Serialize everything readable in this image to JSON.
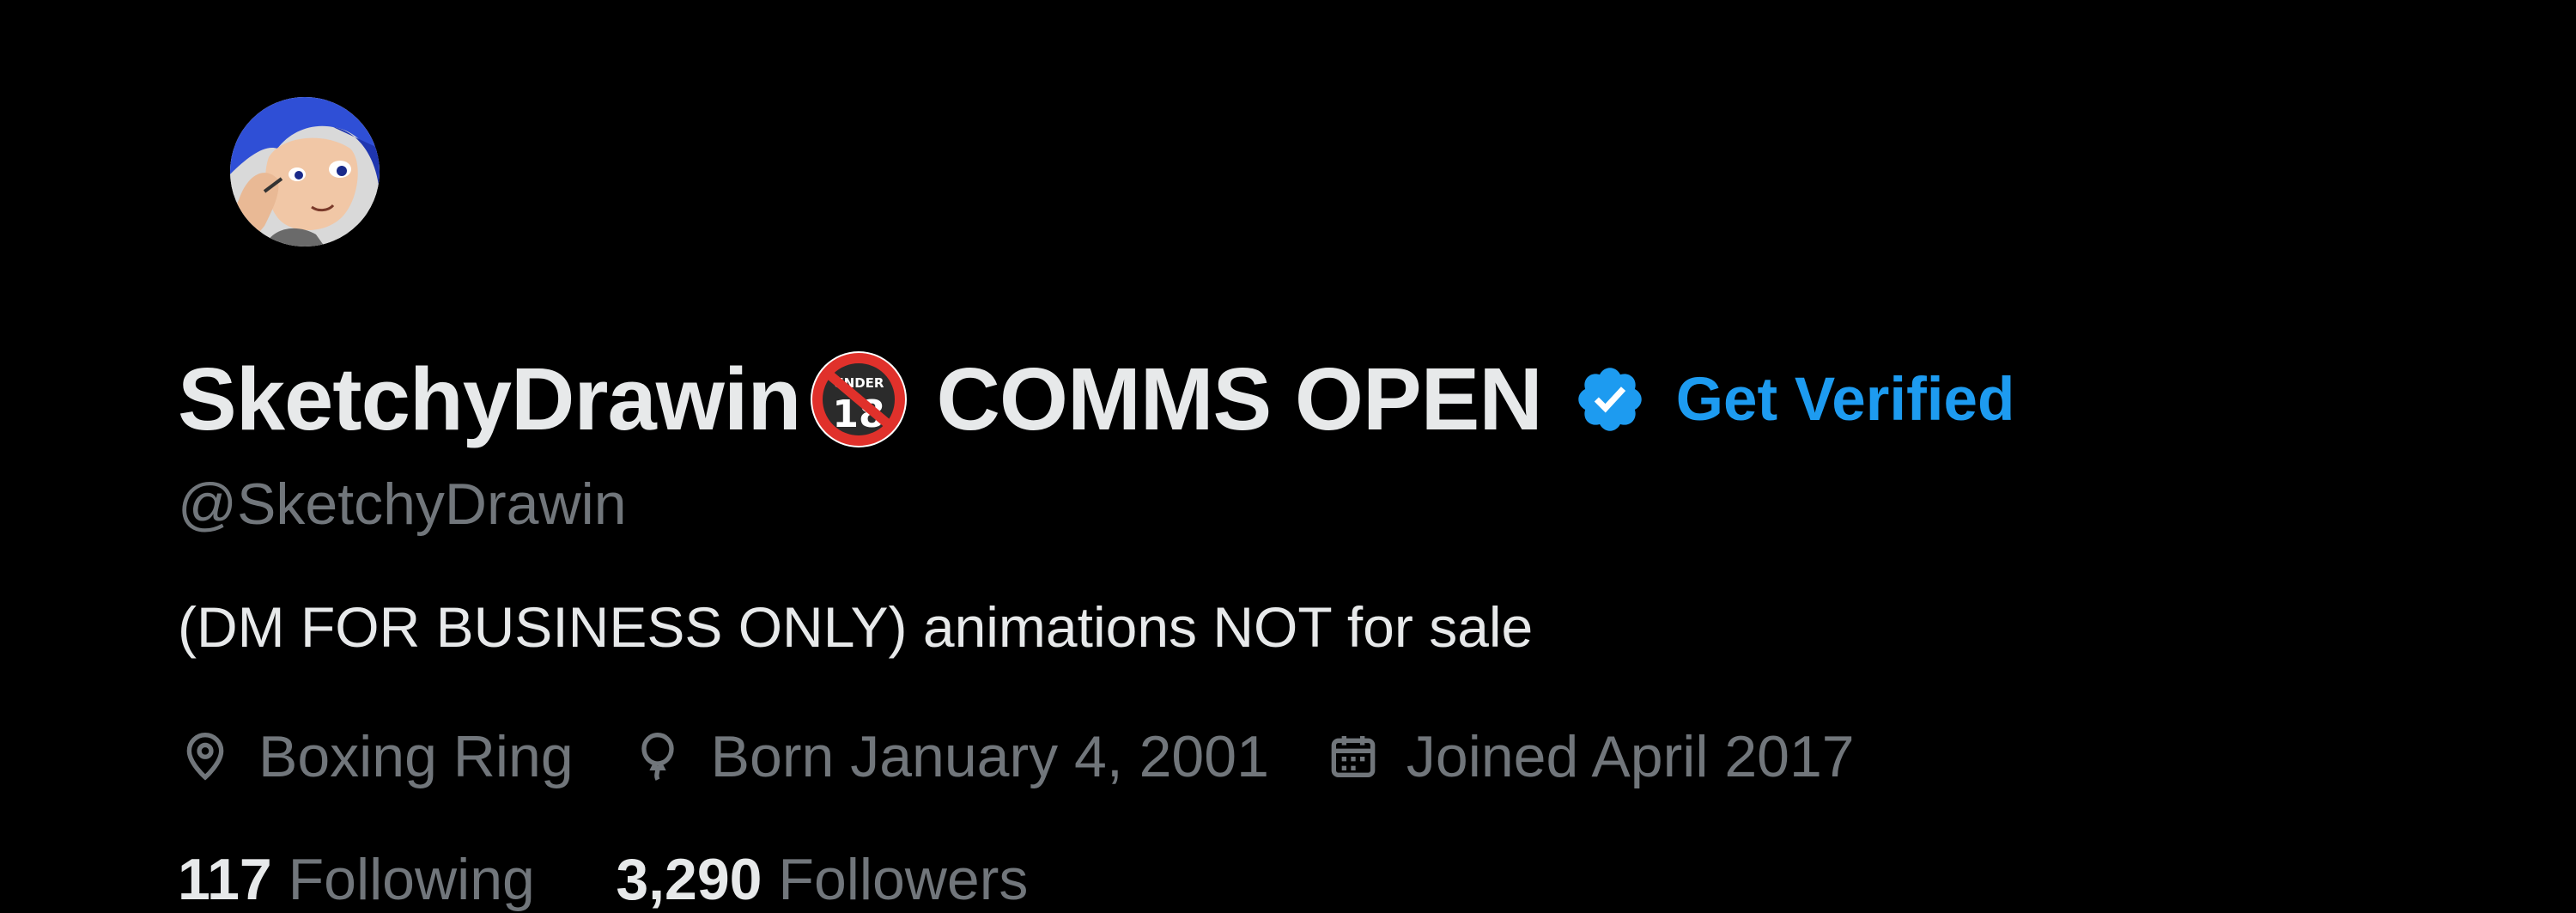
{
  "profile": {
    "display_name": "SketchyDrawin",
    "name_suffix": "COMMS OPEN",
    "under18_badge_text": "UNDER",
    "under18_badge_number": "18",
    "get_verified_label": "Get Verified",
    "handle": "@SketchyDrawin",
    "bio": "(DM FOR BUSINESS ONLY) animations NOT for sale",
    "location": "Boxing Ring",
    "birthday": "Born January 4, 2001",
    "joined": "Joined April 2017",
    "following_count": "117",
    "following_label": "Following",
    "followers_count": "3,290",
    "followers_label": "Followers"
  },
  "icons": {
    "avatar": "avatar-illustration",
    "under18": "no-under-18-icon",
    "verified": "verified-badge-icon",
    "location": "location-pin-icon",
    "birthday": "balloon-icon",
    "joined": "calendar-icon"
  },
  "colors": {
    "background": "#000000",
    "primary_text": "#e7e9ea",
    "secondary_text": "#71767b",
    "accent_blue": "#1d9bf0"
  }
}
